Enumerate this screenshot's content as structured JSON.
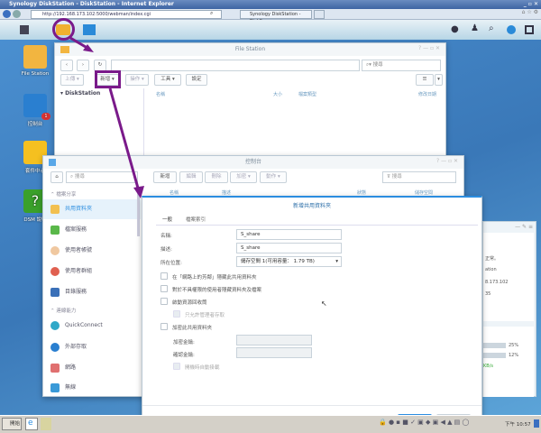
{
  "browser": {
    "title": "Synology DiskStation - DiskStation - Internet Explorer",
    "url": "http://192.168.173.102:5000/webman/index.cgi",
    "tab": "Synology DiskStation - DiskS..."
  },
  "desktop": {
    "icons": [
      {
        "label": "File Station"
      },
      {
        "label": "控制台",
        "badge": "1"
      },
      {
        "label": "套件中心"
      },
      {
        "label": "DSM 說明"
      }
    ]
  },
  "file_station": {
    "title": "File Station",
    "search_placeholder": "搜尋",
    "toolbar": [
      "上傳",
      "新增",
      "操作",
      "工具",
      "設定"
    ],
    "tree_root": "DiskStation",
    "columns": [
      "名稱",
      "大小",
      "檔案類型",
      "修改日期"
    ]
  },
  "control_panel": {
    "title": "控制台",
    "search_placeholder": "搜尋",
    "filter_placeholder": "搜尋",
    "toolbar": [
      "新增",
      "編輯",
      "刪除",
      "加密",
      "動作"
    ],
    "columns": [
      "名稱",
      "描述",
      "狀態",
      "儲存空間"
    ],
    "section1": "檔案分享",
    "section2": "連線能力",
    "items": [
      "共用資料夾",
      "檔案服務",
      "使用者帳號",
      "使用者群組",
      "目錄服務",
      "QuickConnect",
      "外部存取",
      "網路",
      "無線"
    ]
  },
  "dialog": {
    "title": "新增共用資料夾",
    "tabs": [
      "一般",
      "檔案索引"
    ],
    "name_label": "名稱:",
    "name_value": "S_share",
    "desc_label": "描述:",
    "desc_value": "S_share",
    "loc_label": "所在位置:",
    "loc_value": "儲存空間 1(可用容量： 1.79 TB)",
    "opt_hide_network": "在「網路上的芳鄰」隱藏此共用資料夾",
    "opt_hide_noperm": "對於不具權限的使用者隱藏資料夾及檔案",
    "opt_recycle": "啟動資源回收筒",
    "opt_admin_only": "只允許管理者存取",
    "opt_encrypt": "加密此共用資料夾",
    "key_label": "加密金鑰:",
    "confirm_label": "確認金鑰:",
    "opt_automount": "開機時自動掛載",
    "ok": "確定",
    "cancel": "取消"
  },
  "widget": {
    "status": "正常。",
    "host": "ation",
    "ip": "8.173.102",
    "uptime": "35",
    "cpu": "25%",
    "ram": "12%",
    "speed": "KB/s",
    "cpu_value": 25,
    "ram_value": 12
  },
  "taskbar": {
    "start": "開始",
    "clock": "下午 10:57"
  },
  "colors": {
    "accent": "#2b8de0",
    "annotation": "#7a1a8a"
  }
}
